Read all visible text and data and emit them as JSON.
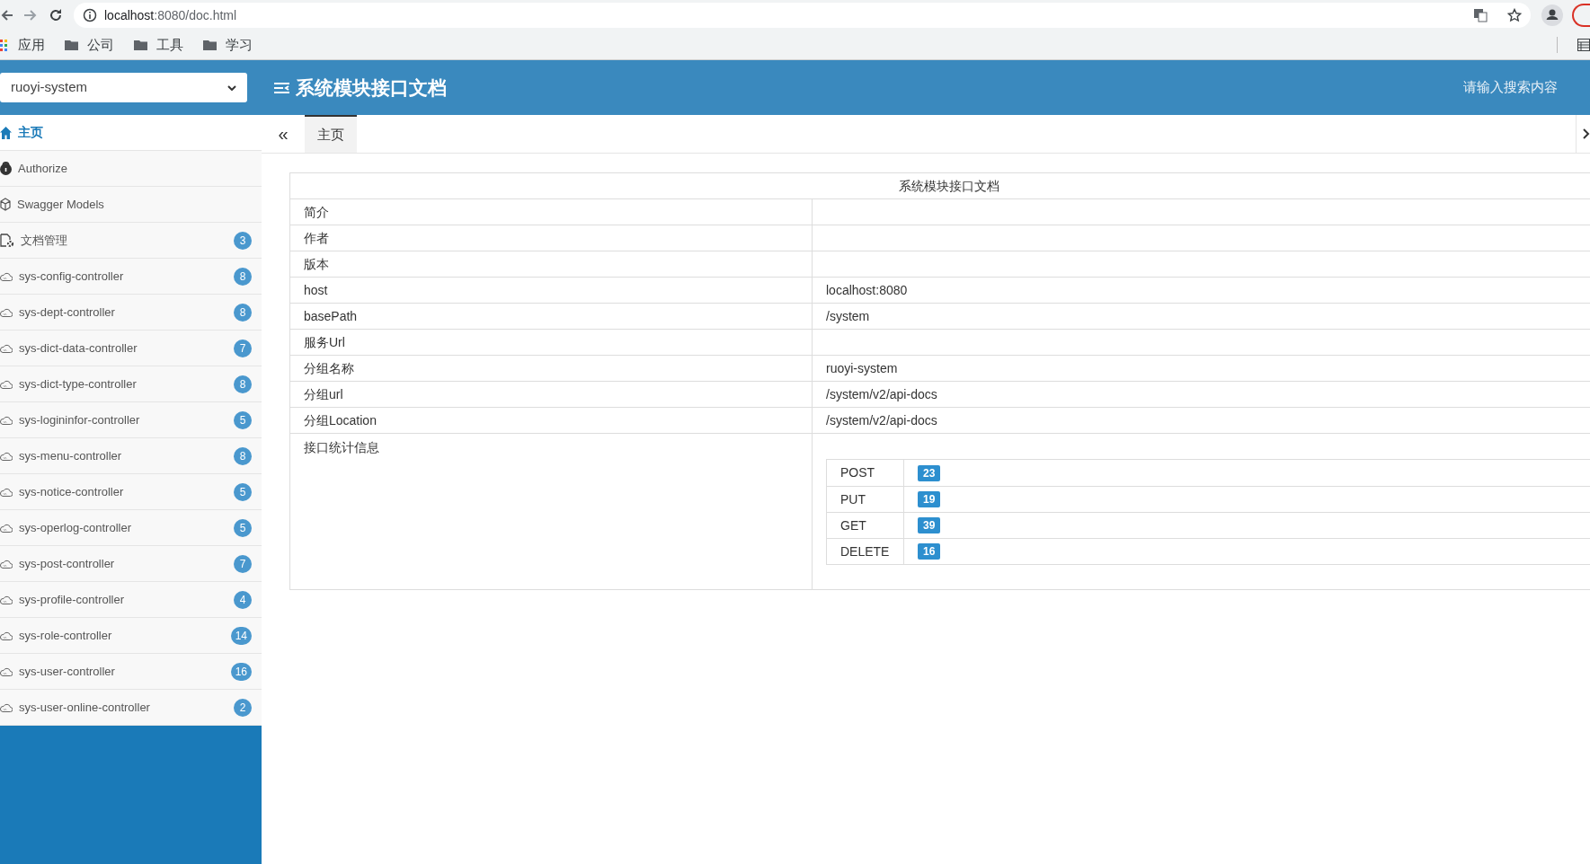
{
  "browser": {
    "url_host": "localhost",
    "url_rest": ":8080/doc.html",
    "bookmarks": [
      {
        "kind": "apps",
        "label": "应用"
      },
      {
        "kind": "folder",
        "label": "公司"
      },
      {
        "kind": "folder",
        "label": "工具"
      },
      {
        "kind": "folder",
        "label": "学习"
      }
    ]
  },
  "header": {
    "group_select": "ruoyi-system",
    "title": "系统模块接口文档",
    "search_placeholder": "请输入搜索内容"
  },
  "sidebar": {
    "items": [
      {
        "kind": "home",
        "label": "主页",
        "selected": true
      },
      {
        "kind": "lock",
        "label": "Authorize",
        "selected": false
      },
      {
        "kind": "models",
        "label": "Swagger Models",
        "selected": false
      },
      {
        "kind": "docs",
        "label": "文档管理",
        "badge": "3",
        "selected": false
      },
      {
        "kind": "api",
        "label": "sys-config-controller",
        "badge": "8",
        "selected": false
      },
      {
        "kind": "api",
        "label": "sys-dept-controller",
        "badge": "8",
        "selected": false
      },
      {
        "kind": "api",
        "label": "sys-dict-data-controller",
        "badge": "7",
        "selected": false
      },
      {
        "kind": "api",
        "label": "sys-dict-type-controller",
        "badge": "8",
        "selected": false
      },
      {
        "kind": "api",
        "label": "sys-logininfor-controller",
        "badge": "5",
        "selected": false
      },
      {
        "kind": "api",
        "label": "sys-menu-controller",
        "badge": "8",
        "selected": false
      },
      {
        "kind": "api",
        "label": "sys-notice-controller",
        "badge": "5",
        "selected": false
      },
      {
        "kind": "api",
        "label": "sys-operlog-controller",
        "badge": "5",
        "selected": false
      },
      {
        "kind": "api",
        "label": "sys-post-controller",
        "badge": "7",
        "selected": false
      },
      {
        "kind": "api",
        "label": "sys-profile-controller",
        "badge": "4",
        "selected": false
      },
      {
        "kind": "api",
        "label": "sys-role-controller",
        "badge": "14",
        "selected": false
      },
      {
        "kind": "api",
        "label": "sys-user-controller",
        "badge": "16",
        "selected": false
      },
      {
        "kind": "api",
        "label": "sys-user-online-controller",
        "badge": "2",
        "selected": false
      }
    ]
  },
  "tab_scroll_left": "«",
  "tabs": [
    {
      "label": "主页",
      "selected": true
    }
  ],
  "doc": {
    "title": "系统模块接口文档",
    "rows": [
      {
        "label": "简介"
      },
      {
        "label": "作者"
      },
      {
        "label": "版本"
      },
      {
        "label": "host",
        "value": "localhost:8080"
      },
      {
        "label": "basePath",
        "value": "/system"
      },
      {
        "label": "服务Url"
      },
      {
        "label": "分组名称",
        "value": "ruoyi-system"
      },
      {
        "label": "分组url",
        "value": "/system/v2/api-docs"
      },
      {
        "label": "分组Location",
        "value": "/system/v2/api-docs"
      }
    ],
    "stats_label": "接口统计信息",
    "stats": [
      {
        "method": "POST",
        "count": "23"
      },
      {
        "method": "PUT",
        "count": "19"
      },
      {
        "method": "GET",
        "count": "39"
      },
      {
        "method": "DELETE",
        "count": "16"
      }
    ]
  }
}
